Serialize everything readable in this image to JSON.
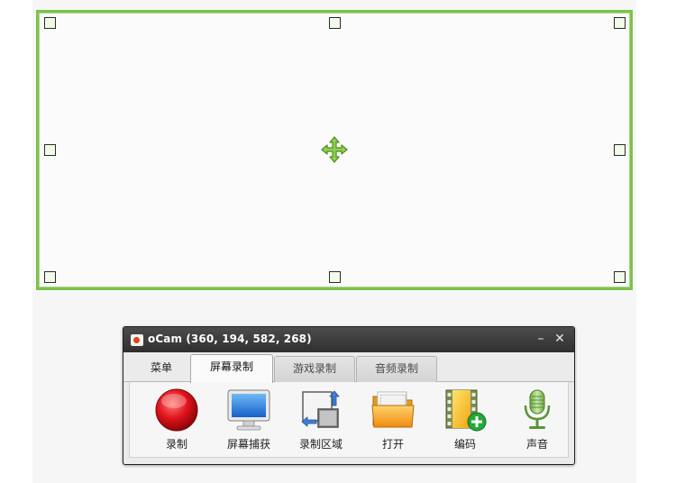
{
  "window": {
    "title": "oCam (360, 194, 582, 268)",
    "minimize_glyph": "–",
    "close_glyph": "✕"
  },
  "tabs": [
    {
      "label": "菜单",
      "state": "plain"
    },
    {
      "label": "屏幕录制",
      "state": "active"
    },
    {
      "label": "游戏录制",
      "state": "inactive"
    },
    {
      "label": "音频录制",
      "state": "inactive"
    }
  ],
  "toolbar": {
    "record_label": "录制",
    "screenshot_label": "屏幕捕获",
    "region_label": "录制区域",
    "open_label": "打开",
    "codec_label": "编码",
    "sound_label": "声音"
  },
  "icons": {
    "record": "record-icon",
    "screenshot": "monitor-icon",
    "region": "resize-region-icon",
    "open": "folder-icon",
    "codec": "film-add-icon",
    "sound": "microphone-icon",
    "move": "move-arrows-icon"
  },
  "colors": {
    "region_border": "#7cc24a",
    "titlebar": "#3a3a3a",
    "record_red": "#d8131b"
  }
}
